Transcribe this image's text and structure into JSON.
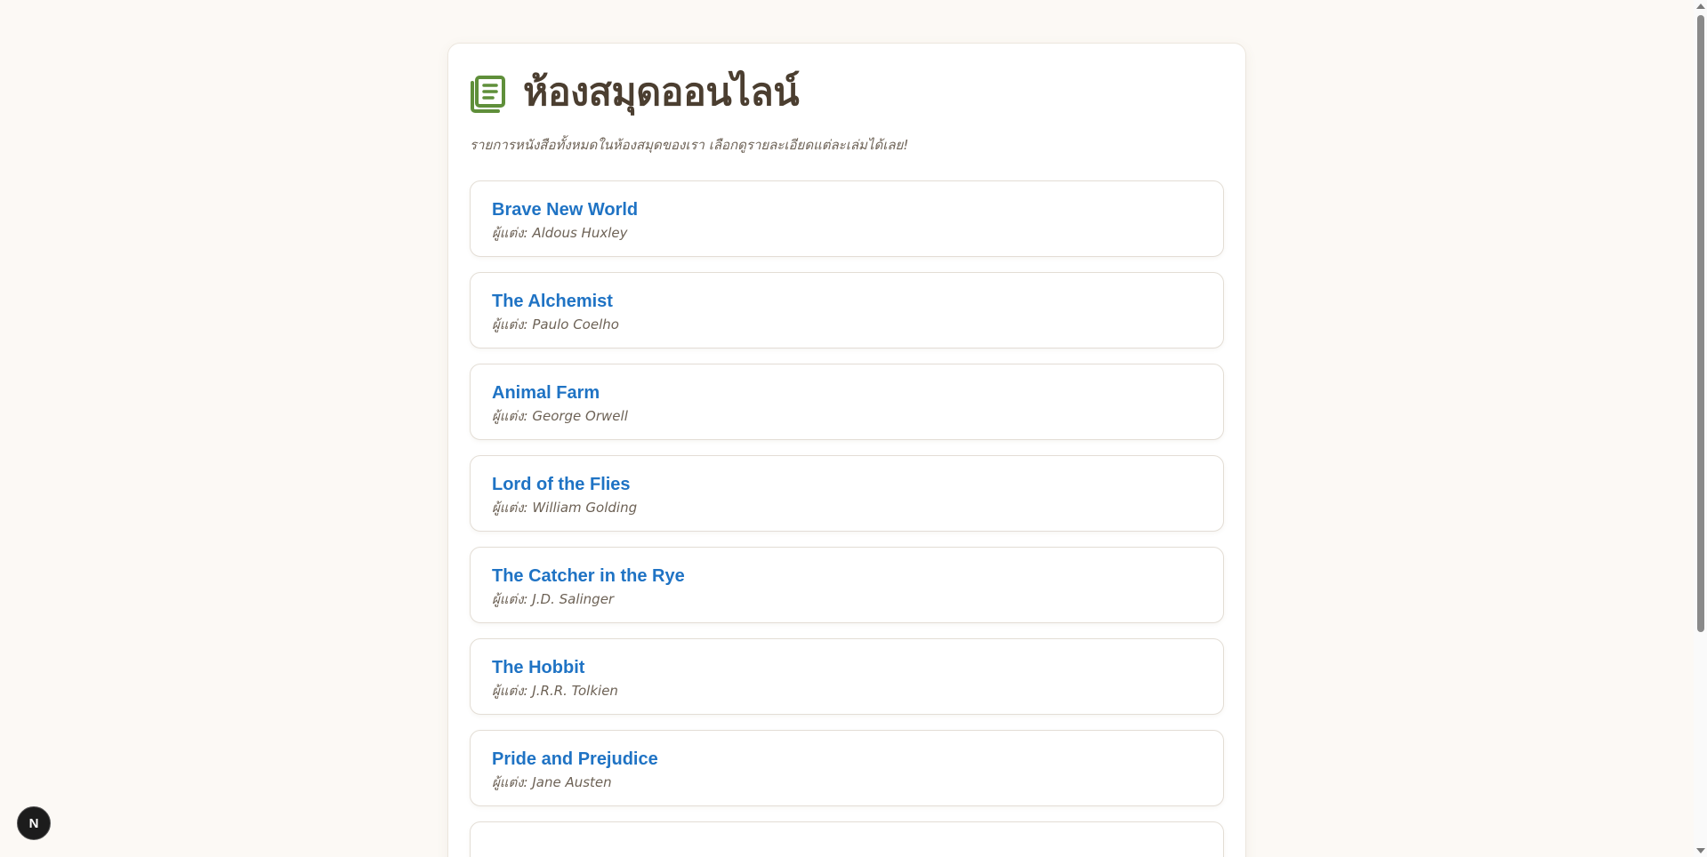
{
  "header": {
    "title": "ห้องสมุดออนไลน์",
    "icon": "book-icon",
    "icon_color": "#5f8f3a"
  },
  "subtitle": "รายการหนังสือทั้งหมดในห้องสมุดของเรา เลือกดูรายละเอียดแต่ละเล่มได้เลย!",
  "author_prefix": "ผู้แต่ง:",
  "books": [
    {
      "title": "Brave New World",
      "author": "ผู้แต่ง: Aldous Huxley"
    },
    {
      "title": "The Alchemist",
      "author": "ผู้แต่ง: Paulo Coelho"
    },
    {
      "title": "Animal Farm",
      "author": "ผู้แต่ง: George Orwell"
    },
    {
      "title": "Lord of the Flies",
      "author": "ผู้แต่ง: William Golding"
    },
    {
      "title": "The Catcher in the Rye",
      "author": "ผู้แต่ง: J.D. Salinger"
    },
    {
      "title": "The Hobbit",
      "author": "ผู้แต่ง: J.R.R. Tolkien"
    },
    {
      "title": "Pride and Prejudice",
      "author": "ผู้แต่ง: Jane Austen"
    }
  ],
  "dev_badge": {
    "label": "N"
  },
  "colors": {
    "background": "#fcf9f5",
    "title": "#4b3e30",
    "link": "#1f73c4",
    "muted": "#6d6256"
  }
}
